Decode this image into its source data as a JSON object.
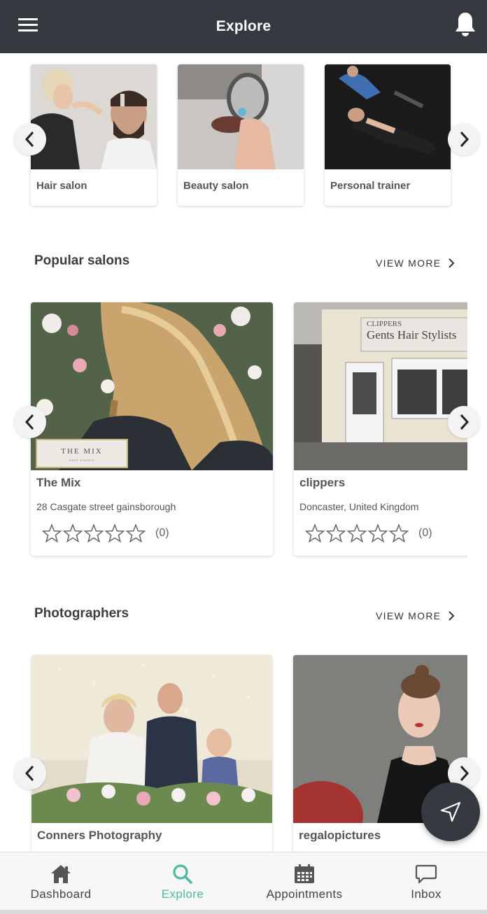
{
  "header": {
    "title": "Explore"
  },
  "categories": [
    {
      "label": "Hair salon"
    },
    {
      "label": "Beauty salon"
    },
    {
      "label": "Personal trainer"
    }
  ],
  "popular_salons": {
    "title": "Popular salons",
    "view_more": "VIEW MORE",
    "items": [
      {
        "name": "The Mix",
        "address": "28 Casgate street gainsborough",
        "rating_count": "(0)",
        "logo_text": "THE MIX",
        "logo_sub": "HAIR STUDIO",
        "stars": 0
      },
      {
        "name": "clippers",
        "address": "Doncaster, United Kingdom",
        "rating_count": "(0)",
        "sign_top": "CLIPPERS",
        "sign_main": "Gents Hair Stylists",
        "stars": 0
      }
    ]
  },
  "photographers": {
    "title": "Photographers",
    "view_more": "VIEW MORE",
    "items": [
      {
        "name": "Conners Photography"
      },
      {
        "name": "regalopictures"
      }
    ]
  },
  "nav": [
    {
      "label": "Dashboard",
      "icon": "home-icon"
    },
    {
      "label": "Explore",
      "icon": "search-icon",
      "active": true
    },
    {
      "label": "Appointments",
      "icon": "calendar-icon"
    },
    {
      "label": "Inbox",
      "icon": "chat-icon"
    }
  ],
  "colors": {
    "header": "#343a40",
    "accent": "#4dbaa0",
    "fab": "#343a40"
  }
}
